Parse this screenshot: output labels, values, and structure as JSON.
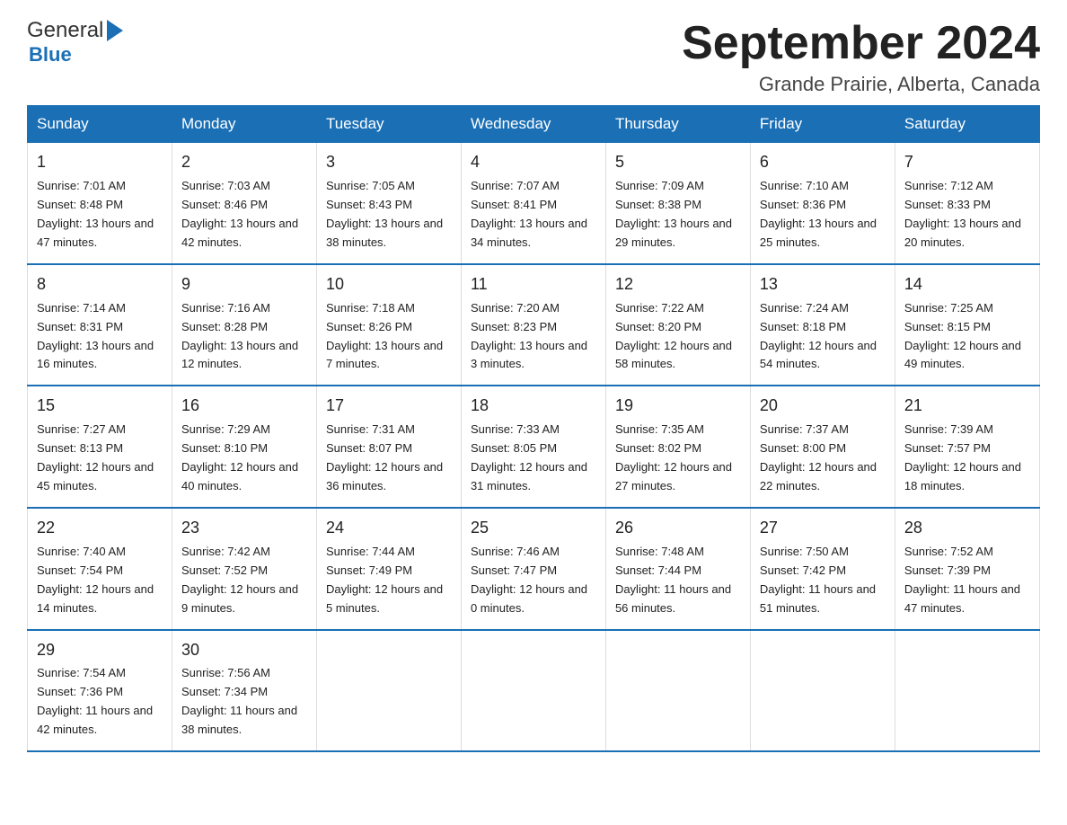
{
  "header": {
    "logo_general": "General",
    "logo_blue": "Blue",
    "month_year": "September 2024",
    "location": "Grande Prairie, Alberta, Canada"
  },
  "weekdays": [
    "Sunday",
    "Monday",
    "Tuesday",
    "Wednesday",
    "Thursday",
    "Friday",
    "Saturday"
  ],
  "weeks": [
    [
      {
        "day": "1",
        "sunrise": "7:01 AM",
        "sunset": "8:48 PM",
        "daylight": "13 hours and 47 minutes."
      },
      {
        "day": "2",
        "sunrise": "7:03 AM",
        "sunset": "8:46 PM",
        "daylight": "13 hours and 42 minutes."
      },
      {
        "day": "3",
        "sunrise": "7:05 AM",
        "sunset": "8:43 PM",
        "daylight": "13 hours and 38 minutes."
      },
      {
        "day": "4",
        "sunrise": "7:07 AM",
        "sunset": "8:41 PM",
        "daylight": "13 hours and 34 minutes."
      },
      {
        "day": "5",
        "sunrise": "7:09 AM",
        "sunset": "8:38 PM",
        "daylight": "13 hours and 29 minutes."
      },
      {
        "day": "6",
        "sunrise": "7:10 AM",
        "sunset": "8:36 PM",
        "daylight": "13 hours and 25 minutes."
      },
      {
        "day": "7",
        "sunrise": "7:12 AM",
        "sunset": "8:33 PM",
        "daylight": "13 hours and 20 minutes."
      }
    ],
    [
      {
        "day": "8",
        "sunrise": "7:14 AM",
        "sunset": "8:31 PM",
        "daylight": "13 hours and 16 minutes."
      },
      {
        "day": "9",
        "sunrise": "7:16 AM",
        "sunset": "8:28 PM",
        "daylight": "13 hours and 12 minutes."
      },
      {
        "day": "10",
        "sunrise": "7:18 AM",
        "sunset": "8:26 PM",
        "daylight": "13 hours and 7 minutes."
      },
      {
        "day": "11",
        "sunrise": "7:20 AM",
        "sunset": "8:23 PM",
        "daylight": "13 hours and 3 minutes."
      },
      {
        "day": "12",
        "sunrise": "7:22 AM",
        "sunset": "8:20 PM",
        "daylight": "12 hours and 58 minutes."
      },
      {
        "day": "13",
        "sunrise": "7:24 AM",
        "sunset": "8:18 PM",
        "daylight": "12 hours and 54 minutes."
      },
      {
        "day": "14",
        "sunrise": "7:25 AM",
        "sunset": "8:15 PM",
        "daylight": "12 hours and 49 minutes."
      }
    ],
    [
      {
        "day": "15",
        "sunrise": "7:27 AM",
        "sunset": "8:13 PM",
        "daylight": "12 hours and 45 minutes."
      },
      {
        "day": "16",
        "sunrise": "7:29 AM",
        "sunset": "8:10 PM",
        "daylight": "12 hours and 40 minutes."
      },
      {
        "day": "17",
        "sunrise": "7:31 AM",
        "sunset": "8:07 PM",
        "daylight": "12 hours and 36 minutes."
      },
      {
        "day": "18",
        "sunrise": "7:33 AM",
        "sunset": "8:05 PM",
        "daylight": "12 hours and 31 minutes."
      },
      {
        "day": "19",
        "sunrise": "7:35 AM",
        "sunset": "8:02 PM",
        "daylight": "12 hours and 27 minutes."
      },
      {
        "day": "20",
        "sunrise": "7:37 AM",
        "sunset": "8:00 PM",
        "daylight": "12 hours and 22 minutes."
      },
      {
        "day": "21",
        "sunrise": "7:39 AM",
        "sunset": "7:57 PM",
        "daylight": "12 hours and 18 minutes."
      }
    ],
    [
      {
        "day": "22",
        "sunrise": "7:40 AM",
        "sunset": "7:54 PM",
        "daylight": "12 hours and 14 minutes."
      },
      {
        "day": "23",
        "sunrise": "7:42 AM",
        "sunset": "7:52 PM",
        "daylight": "12 hours and 9 minutes."
      },
      {
        "day": "24",
        "sunrise": "7:44 AM",
        "sunset": "7:49 PM",
        "daylight": "12 hours and 5 minutes."
      },
      {
        "day": "25",
        "sunrise": "7:46 AM",
        "sunset": "7:47 PM",
        "daylight": "12 hours and 0 minutes."
      },
      {
        "day": "26",
        "sunrise": "7:48 AM",
        "sunset": "7:44 PM",
        "daylight": "11 hours and 56 minutes."
      },
      {
        "day": "27",
        "sunrise": "7:50 AM",
        "sunset": "7:42 PM",
        "daylight": "11 hours and 51 minutes."
      },
      {
        "day": "28",
        "sunrise": "7:52 AM",
        "sunset": "7:39 PM",
        "daylight": "11 hours and 47 minutes."
      }
    ],
    [
      {
        "day": "29",
        "sunrise": "7:54 AM",
        "sunset": "7:36 PM",
        "daylight": "11 hours and 42 minutes."
      },
      {
        "day": "30",
        "sunrise": "7:56 AM",
        "sunset": "7:34 PM",
        "daylight": "11 hours and 38 minutes."
      },
      null,
      null,
      null,
      null,
      null
    ]
  ]
}
